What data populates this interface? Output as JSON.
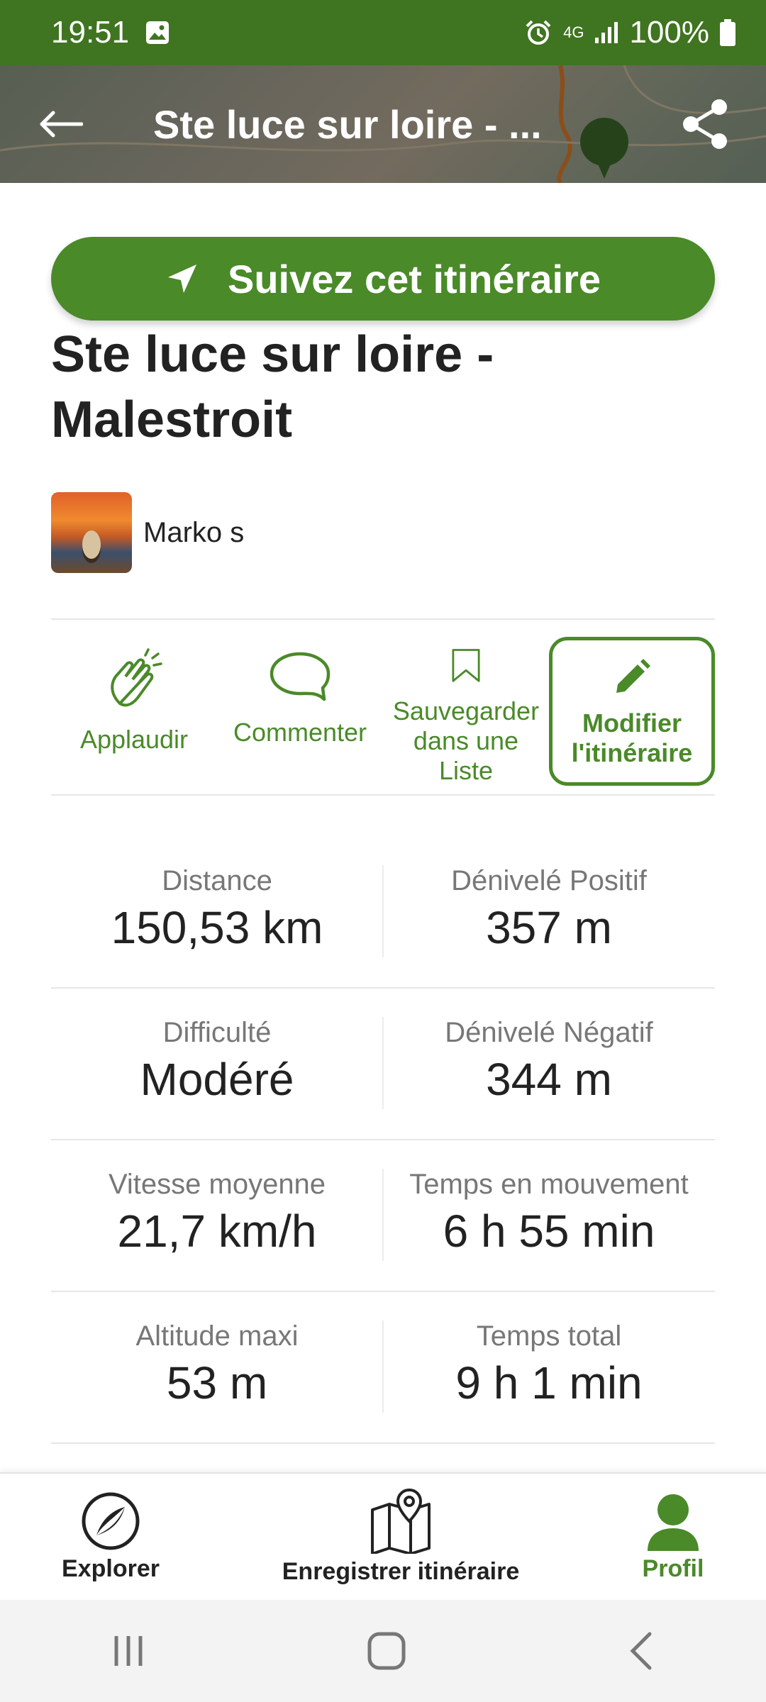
{
  "status_bar": {
    "time": "19:51",
    "network": "4G",
    "battery": "100%"
  },
  "header": {
    "title": "Ste luce sur loire - ..."
  },
  "follow_button": {
    "label": "Suivez cet itinéraire"
  },
  "route": {
    "title_line1": "Ste luce sur loire -",
    "title_line2": "Malestroit"
  },
  "author": {
    "name": "Marko s"
  },
  "actions": [
    {
      "label": "Applaudir",
      "icon": "clap-icon"
    },
    {
      "label": "Commenter",
      "icon": "comment-icon"
    },
    {
      "label_line1": "Sauvegarder",
      "label_line2": "dans une Liste",
      "icon": "bookmark-icon"
    },
    {
      "label_line1": "Modifier",
      "label_line2": "l'itinéraire",
      "icon": "pencil-icon"
    }
  ],
  "stats": [
    {
      "key": "Distance",
      "value": "150,53 km"
    },
    {
      "key": "Dénivelé Positif",
      "value": "357 m"
    },
    {
      "key": "Difficulté",
      "value": "Modéré"
    },
    {
      "key": "Dénivelé Négatif",
      "value": "344 m"
    },
    {
      "key": "Vitesse moyenne",
      "value": "21,7 km/h"
    },
    {
      "key": "Temps en mouvement",
      "value": "6 h 55 min"
    },
    {
      "key": "Altitude maxi",
      "value": "53 m"
    },
    {
      "key": "Temps total",
      "value": "9 h 1 min"
    }
  ],
  "bottom_nav": [
    {
      "label": "Explorer",
      "icon": "compass-icon"
    },
    {
      "label": "Enregistrer itinéraire",
      "icon": "map-pin-icon"
    },
    {
      "label": "Profil",
      "icon": "person-icon",
      "active": true
    }
  ],
  "colors": {
    "brand_green": "#4a8a29",
    "status_green": "#3f7420"
  }
}
